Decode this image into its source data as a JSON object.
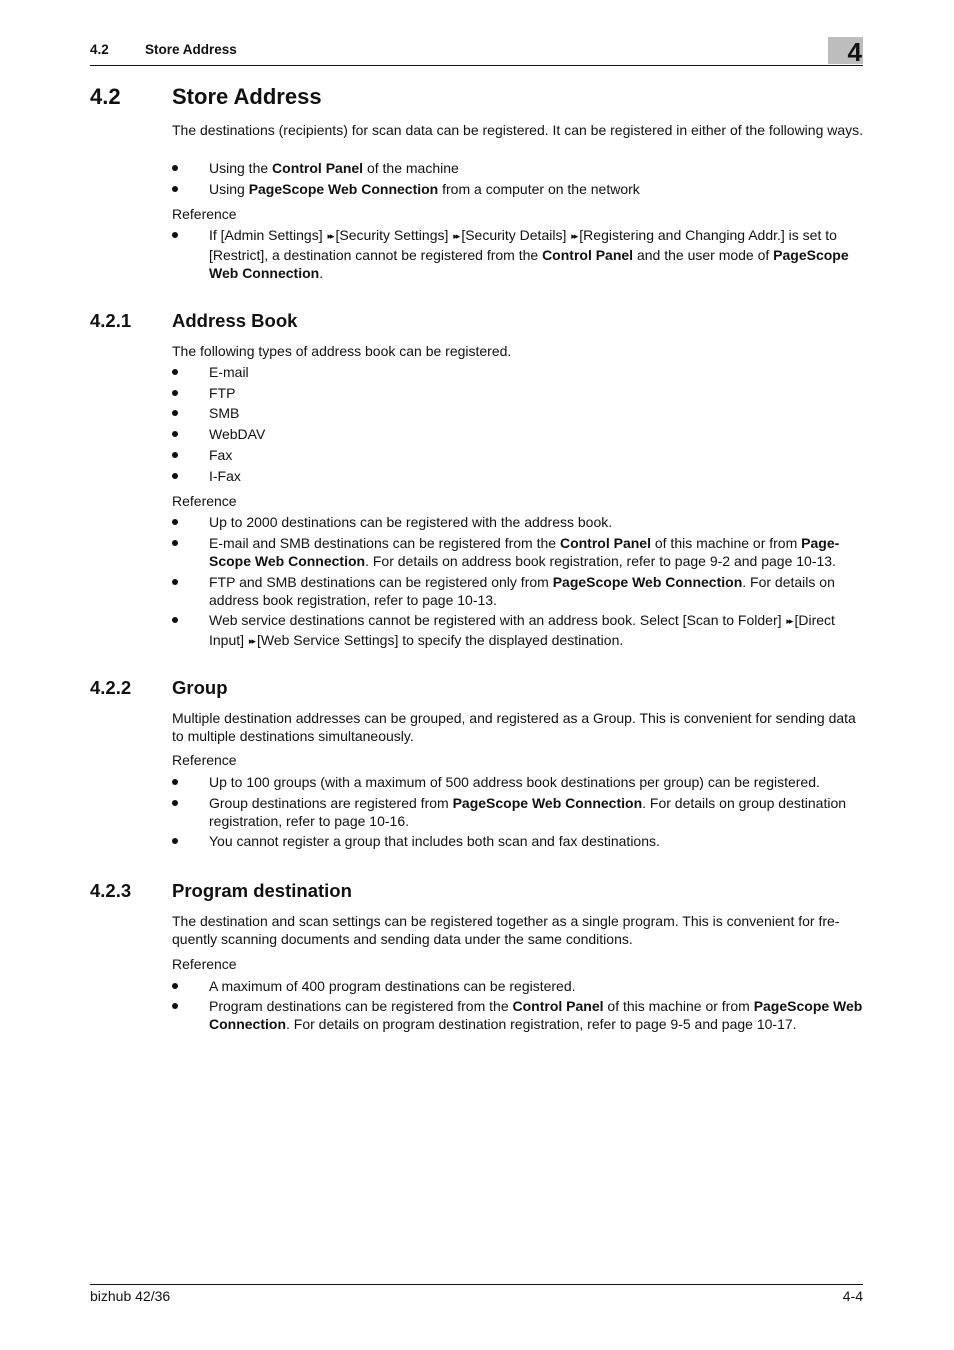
{
  "header": {
    "section_number": "4.2",
    "section_title": "Store Address",
    "chapter_tab": "4"
  },
  "section": {
    "number": "4.2",
    "title": "Store Address",
    "intro": "The destinations (recipients) for scan data can be registered. It can be registered in either of the following ways.",
    "methods": [
      {
        "pre": "Using the ",
        "bold": "Control Panel",
        "post": " of the machine"
      },
      {
        "pre": "Using ",
        "bold": "PageScope Web Connection",
        "post": " from a computer on the network"
      }
    ],
    "reference_label": "Reference",
    "reference": {
      "p1": "If [Admin Settings]",
      "p2": "[Security Settings]",
      "p3": "[Security Details]",
      "p4": "[Registering and Changing Addr.] is set to [Restrict], a destination cannot be registered from the ",
      "bold1": "Control Panel",
      "p5": " and the user mode of ",
      "bold2": "PageScope Web Connection",
      "p6": "."
    }
  },
  "address_book": {
    "number": "4.2.1",
    "title": "Address Book",
    "intro": "The following types of address book can be registered.",
    "types": [
      "E-mail",
      "FTP",
      "SMB",
      "WebDAV",
      "Fax",
      "I-Fax"
    ],
    "reference_label": "Reference",
    "refs": {
      "r1": "Up to 2000 destinations can be registered with the address book.",
      "r2_pre": "E-mail and SMB destinations can be registered from the ",
      "r2_bold1": "Control Panel",
      "r2_mid": " of this machine or from ",
      "r2_bold2": "Page-Scope Web Connection",
      "r2_post": ". For details on address book registration, refer to page 9-2 and page 10-13.",
      "r3_pre": "FTP and SMB destinations can be registered only from ",
      "r3_bold": "PageScope Web Connection",
      "r3_post": ". For details on address book registration, refer to page 10-13.",
      "r4_a": "Web service destinations cannot be registered with an address book. Select [Scan to Folder]",
      "r4_b": "[Direct Input]",
      "r4_c": "[Web Service Settings] to specify the displayed destination."
    }
  },
  "group": {
    "number": "4.2.2",
    "title": "Group",
    "intro": "Multiple destination addresses can be grouped, and registered as a Group. This is convenient for sending data to multiple destinations simultaneously.",
    "reference_label": "Reference",
    "refs": {
      "r1": "Up to 100 groups (with a maximum of 500 address book destinations per group) can be registered.",
      "r2_pre": "Group destinations are registered from ",
      "r2_bold": "PageScope Web Connection",
      "r2_post": ". For details on group destination registration, refer to page 10-16.",
      "r3": "You cannot register a group that includes both scan and fax destinations."
    }
  },
  "program": {
    "number": "4.2.3",
    "title": "Program destination",
    "intro": "The destination and scan settings can be registered together as a single program. This is convenient for fre-quently scanning documents and sending data under the same conditions.",
    "reference_label": "Reference",
    "refs": {
      "r1": "A maximum of 400 program destinations can be registered.",
      "r2_pre": "Program destinations can be registered from the ",
      "r2_bold1": "Control Panel",
      "r2_mid": " of this machine or from ",
      "r2_bold2": "PageScope Web Connection",
      "r2_post": ". For details on program destination registration, refer to page 9-5 and page 10-17."
    }
  },
  "icons": {
    "arrow": "▸▸"
  },
  "footer": {
    "product": "bizhub 42/36",
    "page": "4-4"
  }
}
